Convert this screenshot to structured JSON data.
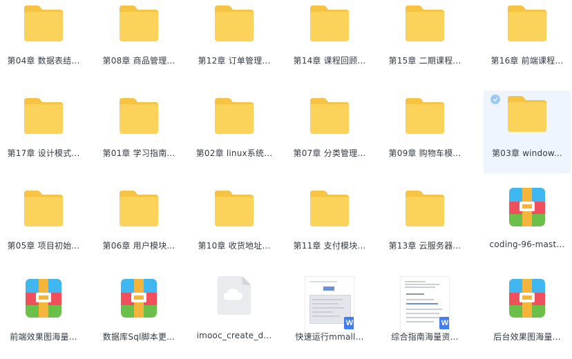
{
  "items": [
    {
      "label": "第04章 数据表结...",
      "type": "folder"
    },
    {
      "label": "第08章 商品管理...",
      "type": "folder"
    },
    {
      "label": "第12章 订单管理...",
      "type": "folder"
    },
    {
      "label": "第14章 课程回顾...",
      "type": "folder"
    },
    {
      "label": "第15章 二期课程...",
      "type": "folder"
    },
    {
      "label": "第16章 前端课程...",
      "type": "folder"
    },
    {
      "label": "第17章 设计模式...",
      "type": "folder"
    },
    {
      "label": "第01章 学习指南...",
      "type": "folder"
    },
    {
      "label": "第02章 linux系统...",
      "type": "folder"
    },
    {
      "label": "第07章 分类管理...",
      "type": "folder"
    },
    {
      "label": "第09章 购物车模...",
      "type": "folder"
    },
    {
      "label": "第03章 window...",
      "type": "folder",
      "selected": true
    },
    {
      "label": "第05章 项目初始...",
      "type": "folder"
    },
    {
      "label": "第06章 用户模块...",
      "type": "folder"
    },
    {
      "label": "第10章 收货地址...",
      "type": "folder"
    },
    {
      "label": "第11章 支付模块...",
      "type": "folder"
    },
    {
      "label": "第13章 云服务器...",
      "type": "folder"
    },
    {
      "label": "coding-96-mast...",
      "type": "archive"
    },
    {
      "label": "前端效果图海量...",
      "type": "archive"
    },
    {
      "label": "数据库Sql脚本更...",
      "type": "archive"
    },
    {
      "label": "imooc_create_d...",
      "type": "cloud-file"
    },
    {
      "label": "快速运行mmall...",
      "type": "word-doc",
      "badge": "W"
    },
    {
      "label": "综合指南海量资...",
      "type": "word-doc",
      "badge": "W"
    },
    {
      "label": "后台效果图海量...",
      "type": "archive"
    }
  ],
  "colors": {
    "folder_back": "#f6c342",
    "folder_front": "#fcd35a",
    "selected_bg": "#eef5fe",
    "check": "#9ec9f6",
    "word_badge": "#3f7ef5",
    "archive_top": "#3fb7f0",
    "archive_red": "#f0505c",
    "archive_green": "#6cc04a",
    "archive_band": "#f5b43a"
  }
}
